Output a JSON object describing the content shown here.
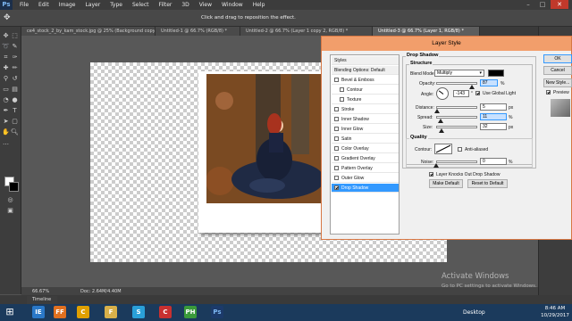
{
  "app": {
    "logo_text": "Ps",
    "menu": [
      "File",
      "Edit",
      "Image",
      "Layer",
      "Type",
      "Select",
      "Filter",
      "3D",
      "View",
      "Window",
      "Help"
    ],
    "window_controls": {
      "minimize": "–",
      "maximize": "□",
      "close": "✕"
    }
  },
  "options_bar": {
    "hint": "Click and drag to reposition the effect."
  },
  "tabs": [
    {
      "label": "ce4_stock_2_by_kam_stock.jpg @ 25% (Background copy, RGB/8) *"
    },
    {
      "label": "Untitled-1 @ 66.7% (RGB/8) *"
    },
    {
      "label": "Untitled-2 @ 66.7% (Layer 1 copy 2, RGB/8) *"
    },
    {
      "label": "Untitled-3 @ 66.7% (Layer 1, RGB/8) *"
    }
  ],
  "status": {
    "zoom": "66.67%",
    "doc_size": "Doc: 2.64M/4.40M",
    "timeline": "Timeline"
  },
  "dialog": {
    "title": "Layer Style",
    "styles_header": "Styles",
    "styles": [
      {
        "label": "Blending Options: Default",
        "checkbox": false,
        "checked": false
      },
      {
        "label": "Bevel & Emboss",
        "checkbox": true,
        "checked": false
      },
      {
        "label": "Contour",
        "checkbox": true,
        "checked": false,
        "indent": true
      },
      {
        "label": "Texture",
        "checkbox": true,
        "checked": false,
        "indent": true
      },
      {
        "label": "Stroke",
        "checkbox": true,
        "checked": false
      },
      {
        "label": "Inner Shadow",
        "checkbox": true,
        "checked": false
      },
      {
        "label": "Inner Glow",
        "checkbox": true,
        "checked": false
      },
      {
        "label": "Satin",
        "checkbox": true,
        "checked": false
      },
      {
        "label": "Color Overlay",
        "checkbox": true,
        "checked": false
      },
      {
        "label": "Gradient Overlay",
        "checkbox": true,
        "checked": false
      },
      {
        "label": "Pattern Overlay",
        "checkbox": true,
        "checked": false
      },
      {
        "label": "Outer Glow",
        "checkbox": true,
        "checked": false
      },
      {
        "label": "Drop Shadow",
        "checkbox": true,
        "checked": true,
        "selected": true
      }
    ],
    "drop_shadow": {
      "section_title": "Drop Shadow",
      "structure_title": "Structure",
      "blend_mode_label": "Blend Mode:",
      "blend_mode_value": "Multiply",
      "shadow_color": "#000000",
      "opacity_label": "Opacity:",
      "opacity_value": "87",
      "opacity_pct": 87,
      "angle_label": "Angle:",
      "angle_value": "-143",
      "angle_unit": "°",
      "use_global_light": "Use Global Light",
      "distance_label": "Distance:",
      "distance_value": "5",
      "distance_pct": 2,
      "spread_label": "Spread:",
      "spread_value": "11",
      "spread_pct": 11,
      "size_label": "Size:",
      "size_value": "32",
      "size_pct": 13,
      "px": "px",
      "pct": "%"
    },
    "quality": {
      "title": "Quality",
      "contour_label": "Contour:",
      "anti_aliased": "Anti-aliased",
      "noise_label": "Noise:",
      "noise_value": "0",
      "noise_pct": 0,
      "layer_knocks_out": "Layer Knocks Out Drop Shadow",
      "make_default": "Make Default",
      "reset_default": "Reset to Default"
    },
    "buttons": {
      "ok": "OK",
      "cancel": "Cancel",
      "new_style": "New Style...",
      "preview": "Preview"
    }
  },
  "taskbar": {
    "start_glyph": "⊞",
    "icons": [
      "IE",
      "FF",
      "C",
      "F",
      "S",
      "C",
      "PH",
      "Ps"
    ],
    "desktop": "Desktop",
    "time": "8:46 AM",
    "date": "10/29/2017"
  },
  "watermark": {
    "title": "Activate Windows",
    "subtitle": "Go to PC settings to activate Windows."
  }
}
